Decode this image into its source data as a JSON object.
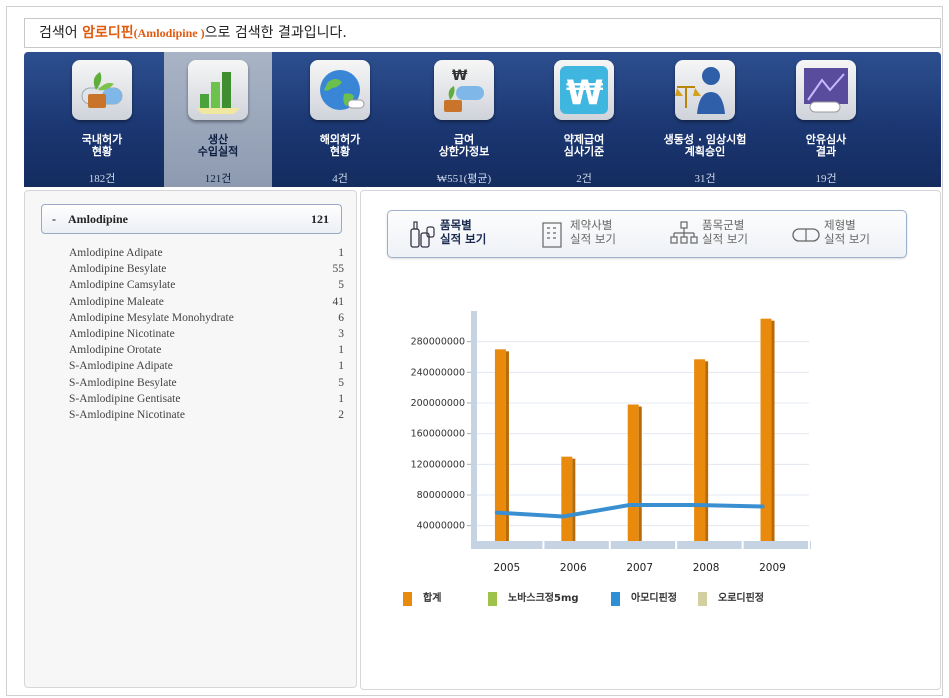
{
  "search": {
    "prefix": "검색어 ",
    "keyword_ko": "암로디핀",
    "keyword_en": "(Amlodipine )",
    "suffix": "으로 검색한 결과입니다."
  },
  "tabs": [
    {
      "name": "domestic-approval",
      "label1": "국내허가",
      "label2": "현황",
      "label3": "",
      "count": "182건",
      "icon": "pills-plant-icon"
    },
    {
      "name": "production-import",
      "label1": "생산",
      "label2": "수입실적",
      "label3": "",
      "count": "121건",
      "icon": "bar-chart-icon"
    },
    {
      "name": "foreign-approval",
      "label1": "해외허가",
      "label2": "현황",
      "label3": "",
      "count": "4건",
      "icon": "globe-icon"
    },
    {
      "name": "reimbursement-price",
      "label1": "급여",
      "label2": "상한가정보",
      "label3": "",
      "count": "₩551(평균)",
      "icon": "won-pills-icon"
    },
    {
      "name": "drug-reimbursement",
      "label1": "약제급여",
      "label2": "심사기준",
      "label3": "",
      "count": "2건",
      "icon": "won-sign-icon"
    },
    {
      "name": "bioequivalence",
      "label1": "생동성 · 임상시험",
      "label2": "계획승인",
      "label3": "",
      "count": "31건",
      "icon": "scales-person-icon"
    },
    {
      "name": "similarity-review",
      "label1": "안유심사",
      "label2": "결과",
      "label3": "",
      "count": "19건",
      "icon": "lab-flask-icon"
    }
  ],
  "active_tab": 1,
  "ingredient": {
    "dash": "-",
    "name": "Amlodipine",
    "count": "121"
  },
  "salts": [
    {
      "name": "Amlodipine Adipate",
      "count": "1"
    },
    {
      "name": "Amlodipine Besylate",
      "count": "55"
    },
    {
      "name": "Amlodipine Camsylate",
      "count": "5"
    },
    {
      "name": "Amlodipine Maleate",
      "count": "41"
    },
    {
      "name": "Amlodipine Mesylate Monohydrate",
      "count": "6"
    },
    {
      "name": "Amlodipine Nicotinate",
      "count": "3"
    },
    {
      "name": "Amlodipine Orotate",
      "count": "1"
    },
    {
      "name": "S-Amlodipine Adipate",
      "count": "1"
    },
    {
      "name": "S-Amlodipine Besylate",
      "count": "5"
    },
    {
      "name": "S-Amlodipine Gentisate",
      "count": "1"
    },
    {
      "name": "S-Amlodipine Nicotinate",
      "count": "2"
    }
  ],
  "view_tabs": [
    {
      "name": "by-product",
      "l1": "품목별",
      "l2": "실적 보기",
      "icon": "product-bottles-icon",
      "active": true
    },
    {
      "name": "by-company",
      "l1": "제약사별",
      "l2": "실적 보기",
      "icon": "building-icon",
      "active": false
    },
    {
      "name": "by-product-group",
      "l1": "품목군별",
      "l2": "실적 보기",
      "icon": "hierarchy-icon",
      "active": false
    },
    {
      "name": "by-formulation",
      "l1": "제형별",
      "l2": "실적 보기",
      "icon": "capsule-icon",
      "active": false
    }
  ],
  "colors": {
    "bar": "#e98a0c",
    "line": "#3a8fd0",
    "legend": [
      "#e98a0c",
      "#9ec24a",
      "#2f8fd6",
      "#d2cfa0"
    ]
  },
  "chart_data": {
    "type": "bar",
    "categories": [
      "2005",
      "2006",
      "2007",
      "2008",
      "2009"
    ],
    "series": [
      {
        "name": "합계",
        "type": "bar",
        "values": [
          270000000,
          130000000,
          198000000,
          257000000,
          310000000
        ]
      },
      {
        "name": "아모디핀정",
        "type": "line",
        "values": [
          57000000,
          52000000,
          67000000,
          67000000,
          65000000
        ]
      }
    ],
    "yticks": [
      "280000000",
      "240000000",
      "200000000",
      "160000000",
      "120000000",
      "80000000",
      "40000000"
    ],
    "ytick_values": [
      280000000,
      240000000,
      200000000,
      160000000,
      120000000,
      80000000,
      40000000
    ],
    "ylim": [
      20000000,
      320000000
    ],
    "legend": [
      "합계",
      "노바스크정5mg",
      "아모디핀정",
      "오로디핀정"
    ],
    "legend_position": "bottom",
    "grid": true
  }
}
